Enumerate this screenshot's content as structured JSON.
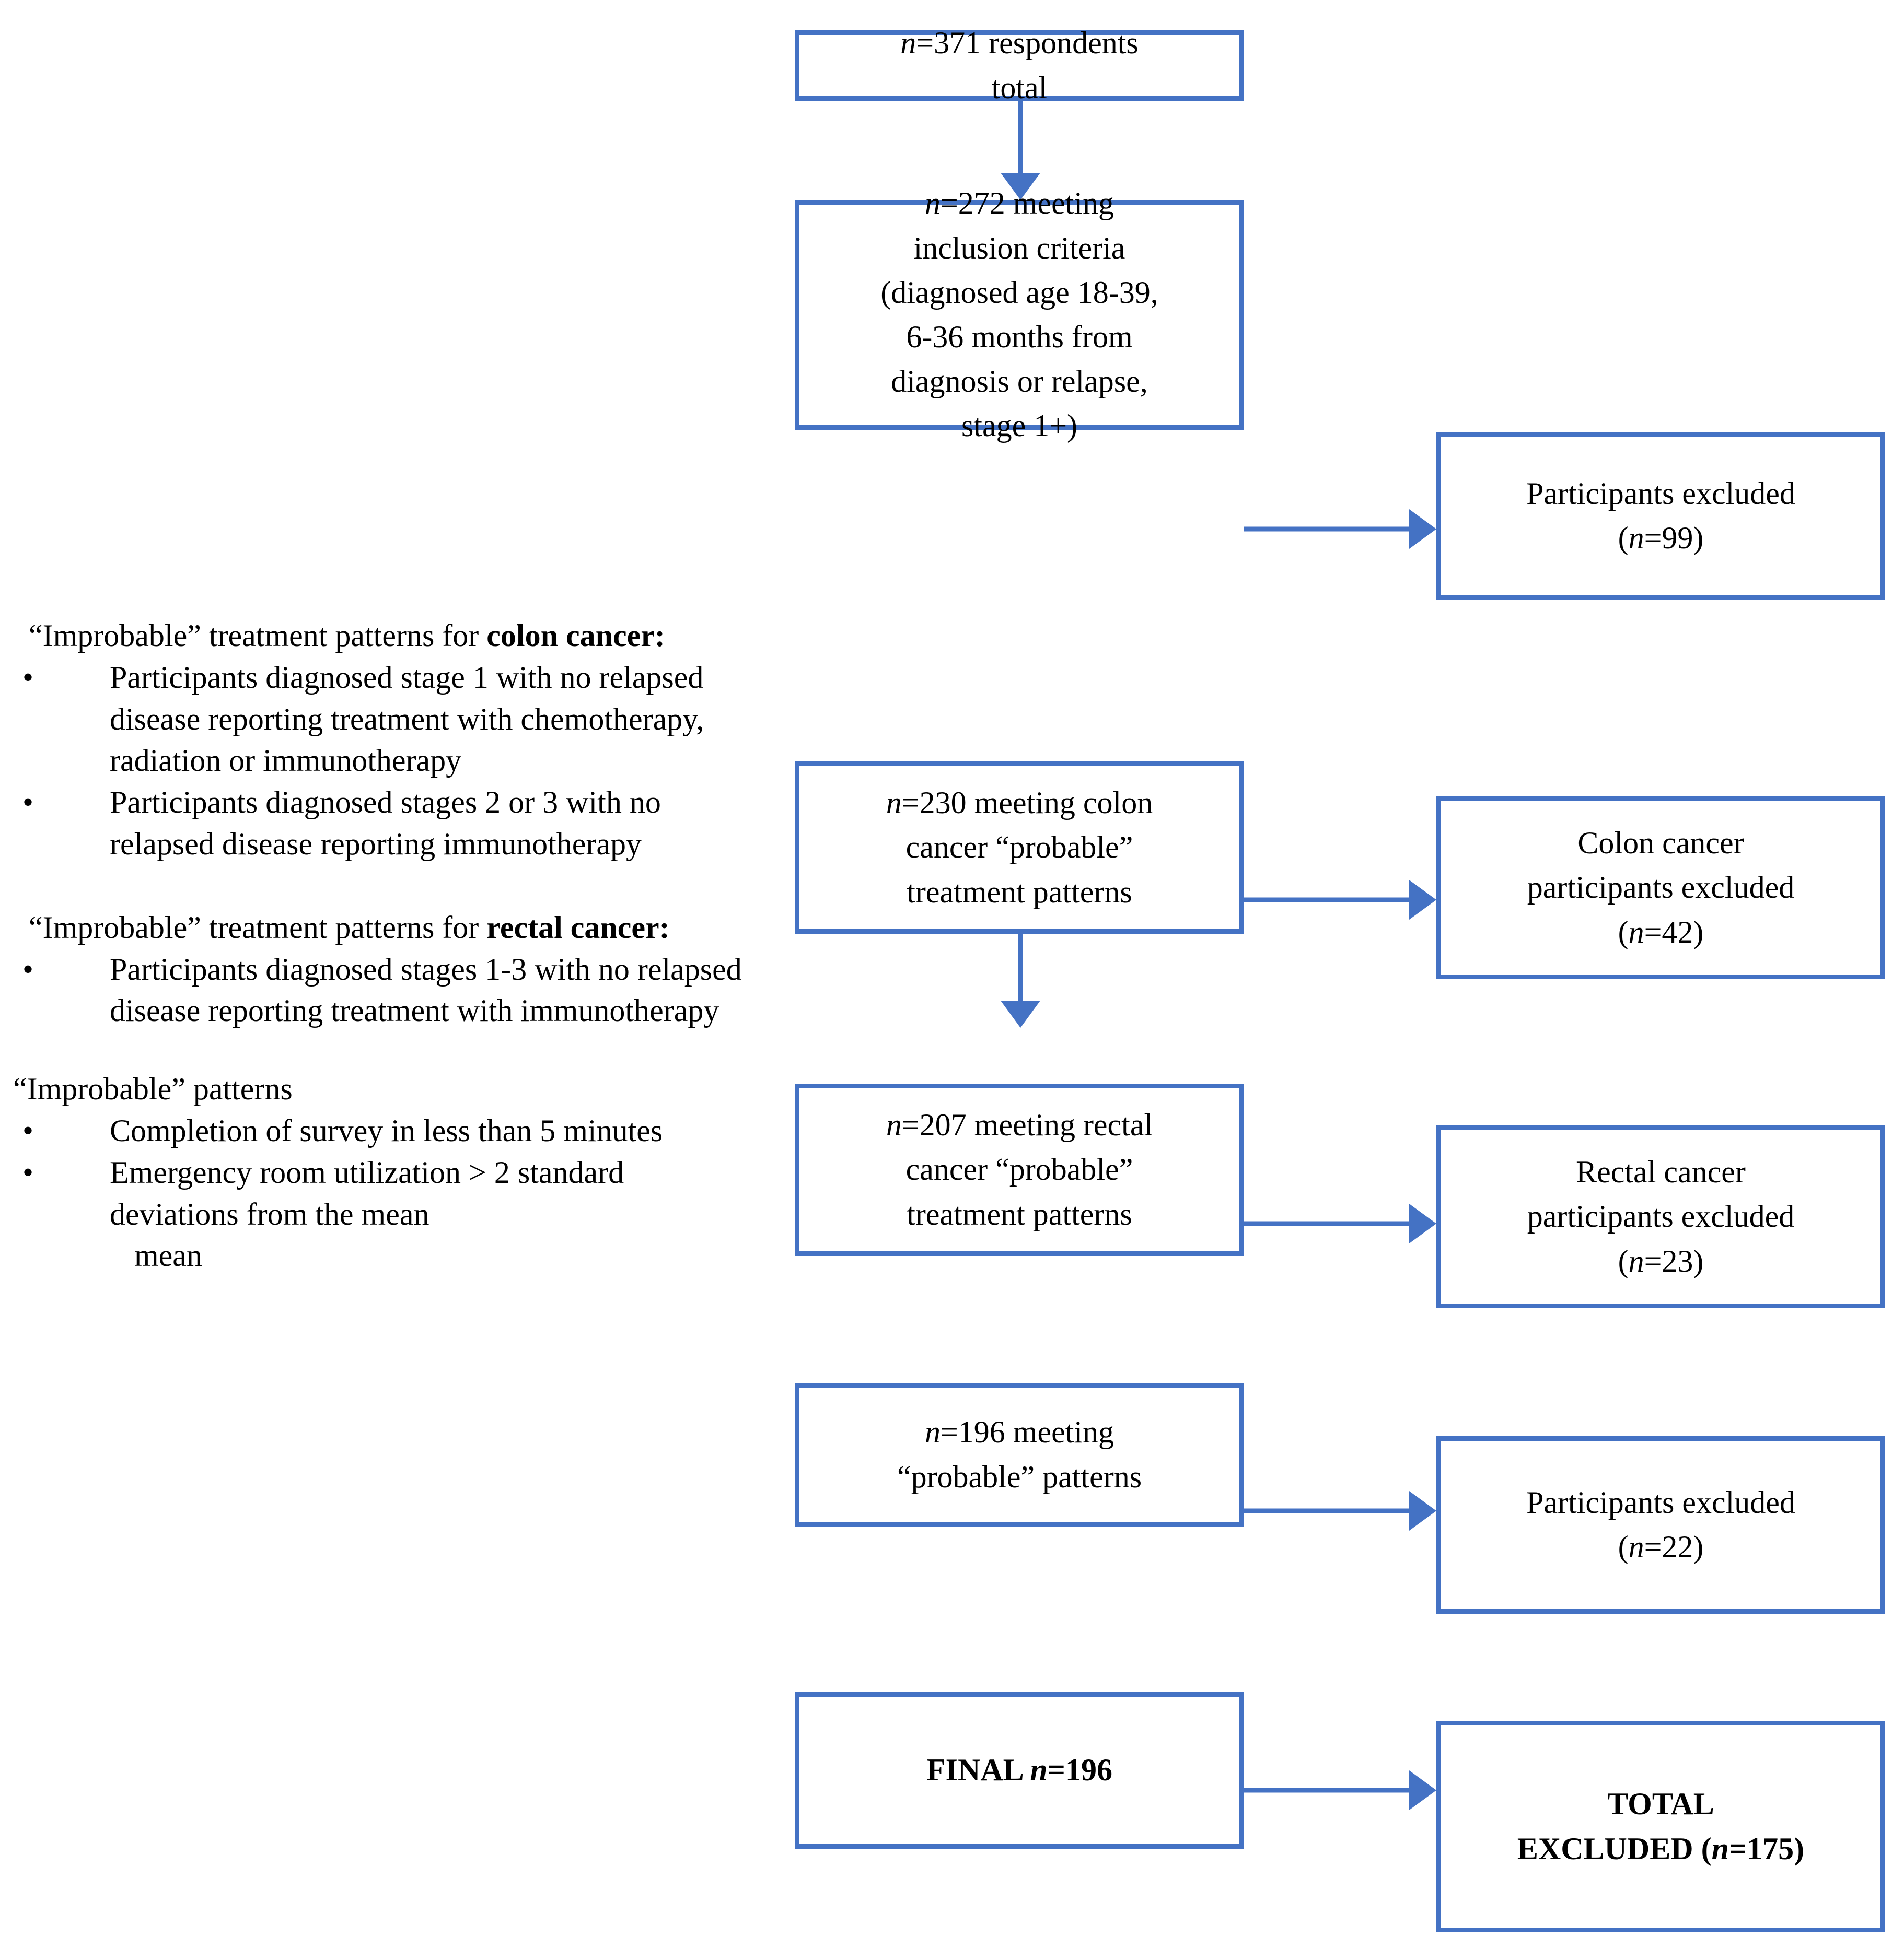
{
  "colors": {
    "accent_blue": "#4472C4",
    "text": "#000000",
    "background": "#FFFFFF"
  },
  "left_column": {
    "colon_section": {
      "heading_prefix": "“Improbable” treatment patterns for ",
      "heading_bold": "colon cancer",
      "heading_suffix": ":",
      "bullets": [
        "Participants diagnosed stage 1 with no relapsed disease reporting treatment with chemotherapy, radiation or immunotherapy",
        "Participants diagnosed stages 2 or 3 with no relapsed disease reporting immunotherapy"
      ]
    },
    "rectal_section": {
      "heading_prefix": "“Improbable” treatment patterns for ",
      "heading_bold": "rectal cancer",
      "heading_suffix": ":",
      "bullets": [
        "Participants diagnosed stages 1-3 with no relapsed disease reporting treatment with immunotherapy"
      ]
    },
    "patterns_section": {
      "heading": "“Improbable” patterns",
      "bullets": [
        "Completion of survey in less than 5 minutes",
        "Emergency room utilization > 2 standard deviations from the mean"
      ],
      "trailing_word": "mean"
    },
    "bullet_glyph": "•"
  },
  "flow": {
    "nodes": [
      {
        "id": "respondents-total",
        "line1_italic": "n",
        "line1_rest": "=371 respondents",
        "line2": "total"
      },
      {
        "id": "inclusion-criteria",
        "line1_italic": "n",
        "line1_rest": "=272 meeting",
        "rest": "inclusion criteria\n(diagnosed age 18-39,\n6-36 months from\ndiagnosis or relapse,\nstage 1+)"
      },
      {
        "id": "colon-probable",
        "line1_italic": "n",
        "line1_rest": "=230 meeting colon",
        "rest": "cancer “probable”\ntreatment patterns"
      },
      {
        "id": "rectal-probable",
        "line1_italic": "n",
        "line1_rest": "=207 meeting rectal",
        "rest": "cancer “probable”\ntreatment patterns"
      },
      {
        "id": "probable-patterns",
        "line1_italic": "n",
        "line1_rest": "=196 meeting",
        "rest": "“probable” patterns"
      },
      {
        "id": "final",
        "prefix": "FINAL ",
        "italic": "n",
        "suffix": "=196"
      }
    ],
    "exclusions": [
      {
        "id": "excluded-99",
        "line1": "Participants excluded",
        "paren_open": "(",
        "italic": "n",
        "value": "=99",
        "paren_close": ")"
      },
      {
        "id": "colon-excluded-42",
        "line1": "Colon cancer",
        "line2": "participants excluded",
        "paren_open": "(",
        "italic": "n",
        "value": "=42",
        "paren_close": ")"
      },
      {
        "id": "rectal-excluded-23",
        "line1": "Rectal cancer",
        "line2": "participants excluded",
        "paren_open": "(",
        "italic": "n",
        "value": "=23",
        "paren_close": ")"
      },
      {
        "id": "excluded-22",
        "line1": "Participants excluded",
        "paren_open": "(",
        "italic": "n",
        "value": "=22",
        "paren_close": ")"
      },
      {
        "id": "total-excluded-175",
        "line1": "TOTAL",
        "line2_prefix": "EXCLUDED (",
        "italic": "n",
        "value": "=175",
        "line2_suffix": ")"
      }
    ]
  }
}
